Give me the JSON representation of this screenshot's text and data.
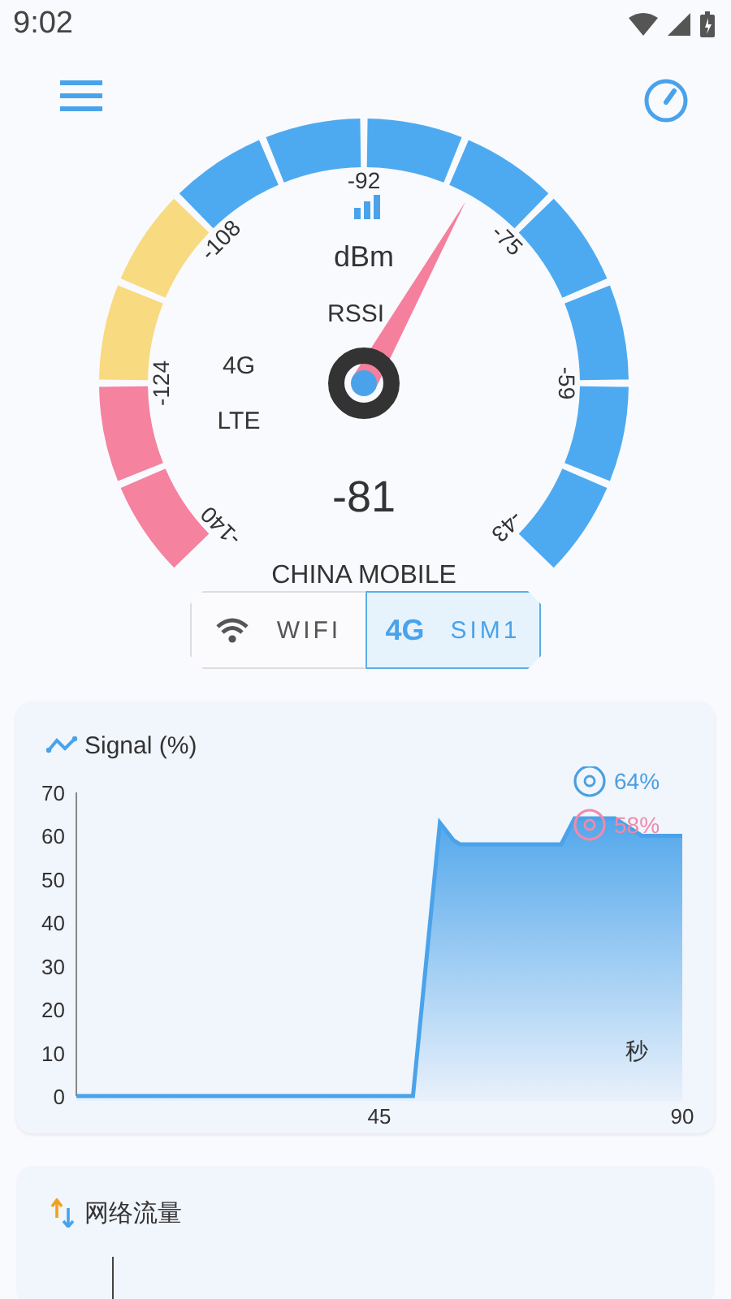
{
  "status_bar": {
    "time": "9:02"
  },
  "gauge": {
    "unit": "dBm",
    "metric": "RSSI",
    "network": "4G",
    "technology": "LTE",
    "reading": "-81",
    "operator": "CHINA MOBILE",
    "ticks": [
      "-140",
      "-124",
      "-108",
      "-92",
      "-75",
      "-59",
      "-43"
    ],
    "segments": [
      {
        "color": "#f5829f"
      },
      {
        "color": "#f5829f"
      },
      {
        "color": "#f8da80"
      },
      {
        "color": "#f8da80"
      },
      {
        "color": "#4eaaf0"
      },
      {
        "color": "#4eaaf0"
      },
      {
        "color": "#4eaaf0"
      },
      {
        "color": "#4eaaf0"
      },
      {
        "color": "#4eaaf0"
      },
      {
        "color": "#4eaaf0"
      },
      {
        "color": "#4eaaf0"
      },
      {
        "color": "#4eaaf0"
      }
    ]
  },
  "connection_tabs": [
    {
      "label": "WIFI",
      "kind": "wifi",
      "selected": false
    },
    {
      "badge": "4G",
      "label": "SIM1",
      "kind": "sim",
      "selected": true
    }
  ],
  "signal_card": {
    "title": "Signal (%)",
    "legend": [
      {
        "text": "64%",
        "color": "#4a9fe0"
      },
      {
        "text": "58%",
        "color": "#f08aa8"
      }
    ],
    "chart_data": {
      "type": "area",
      "xlabel": "秒",
      "x": [
        0,
        45,
        50,
        54,
        56,
        57,
        72,
        74,
        80,
        84,
        90
      ],
      "series": [
        {
          "color": "#4aa3ea",
          "values": [
            0,
            0,
            0,
            63,
            59,
            58,
            58,
            64,
            64,
            60,
            60
          ]
        }
      ],
      "xlim": [
        0,
        90
      ],
      "ylim": [
        0,
        70
      ],
      "xticks": [
        45,
        90
      ],
      "yticks": [
        0,
        10,
        20,
        30,
        40,
        50,
        60,
        70
      ]
    }
  },
  "traffic_card": {
    "title": "网络流量"
  }
}
